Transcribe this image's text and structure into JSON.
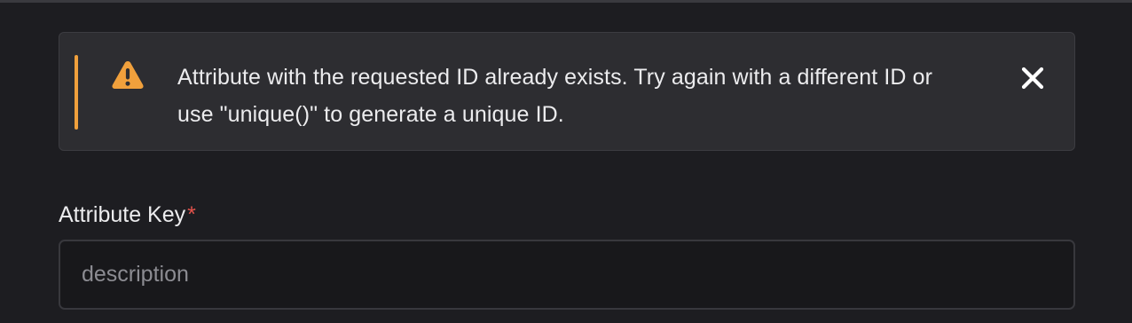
{
  "alert": {
    "icon": "warning-triangle-icon",
    "accent_color": "#f0a03c",
    "message": "Attribute with the requested ID already exists. Try again with a different ID or use \"unique()\" to generate a unique ID.",
    "close_icon": "close-icon"
  },
  "form": {
    "attribute_key": {
      "label": "Attribute Key",
      "required_marker": "*",
      "required_color": "#e2524b",
      "placeholder": "description",
      "value": ""
    }
  }
}
